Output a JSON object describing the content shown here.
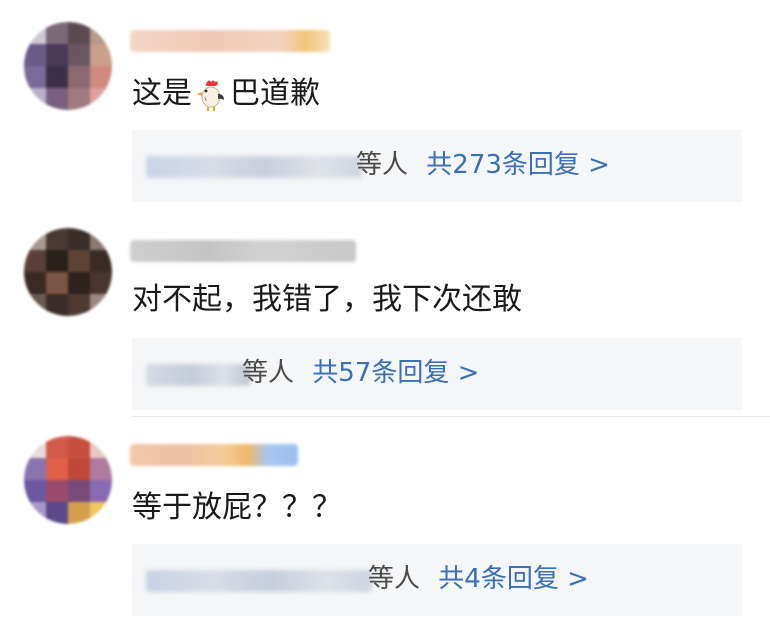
{
  "comments": [
    {
      "text_before": "这是",
      "emoji": "rooster-emoji",
      "text_after": "巴道歉",
      "reply_suffix": "等人",
      "reply_count": "共273条回复 >"
    },
    {
      "text": "对不起，我错了，我下次还敢",
      "reply_suffix": "等人",
      "reply_count": "共57条回复 >"
    },
    {
      "text": "等于放屁？？？",
      "reply_suffix": "等人",
      "reply_count": "共4条回复 >"
    }
  ],
  "colors": {
    "link": "#3b6fb6",
    "reply_background": "#f5f6f8",
    "text": "#1a1a1a"
  }
}
